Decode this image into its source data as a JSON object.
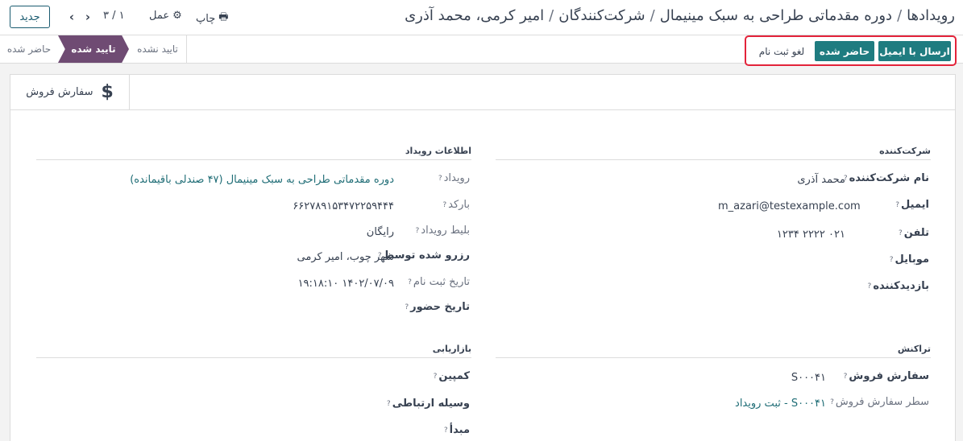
{
  "header": {
    "new_button": "جدید",
    "pager": "۳ / ۱",
    "action_label": "عمل",
    "print_label": "چاپ",
    "breadcrumb": [
      "رویدادها",
      "دوره مقدماتی طراحی به سبک مینیمال",
      "شرکت‌کنندگان",
      "امیر کرمی، محمد آذری"
    ]
  },
  "statusbar": {
    "stages": {
      "done": "حاضر شده",
      "confirmed": "تایید شده",
      "unconfirmed": "تایید نشده"
    },
    "buttons": {
      "send_email": "ارسال با ایمیل",
      "attended": "حاضر شده",
      "cancel": "لغو ثبت نام"
    }
  },
  "smart_button": {
    "label": "سفارش فروش",
    "icon": "dollar-icon"
  },
  "attendee": {
    "title": "شرکت‌کننده",
    "name_label": "نام شرکت‌کننده",
    "name_value": "محمد آذری",
    "email_label": "ایمیل",
    "email_value": "m_azari@testexample.com",
    "phone_label": "تلفن",
    "phone_value": "۰۲۱ ۲۲۲۲ ۱۲۳۴",
    "mobile_label": "موبایل",
    "visitor_label": "بازدیدکننده"
  },
  "event_info": {
    "title": "اطلاعات رویداد",
    "event_label": "رویداد",
    "event_value": "دوره مقدماتی طراحی به سبک مینیمال (۴۷ صندلی باقیمانده)",
    "barcode_label": "بارکد",
    "barcode_value": "۶۶۲۷۸۹۱۵۳۴۷۲۲۵۹۴۴۴",
    "ticket_label": "بلیط رویداد",
    "ticket_value": "رایگان",
    "booked_label": "رزرو شده توسط",
    "booked_value": "شهر چوب، امیر کرمی",
    "reg_date_label": "تاریخ ثبت نام",
    "reg_date_value": "۱۴۰۲/۰۷/۰۹ ۱۹:۱۸:۱۰",
    "attend_date_label": "تاریخ حضور"
  },
  "transaction": {
    "title": "تراکنش",
    "sale_order_label": "سفارش فروش",
    "sale_order_value": "S۰۰۰۴۱",
    "sale_line_label": "سطر سفارش فروش",
    "sale_line_value": "S۰۰۰۴۱ - ثبت رویداد"
  },
  "marketing": {
    "title": "بازاریابی",
    "campaign_label": "کمپین",
    "medium_label": "وسیله ارتباطی",
    "source_label": "مبدأ"
  },
  "colors": {
    "accent": "#1f7c80",
    "active_stage": "#6f4b73",
    "highlight_border": "#e3233a",
    "link": "#1f6d76"
  }
}
